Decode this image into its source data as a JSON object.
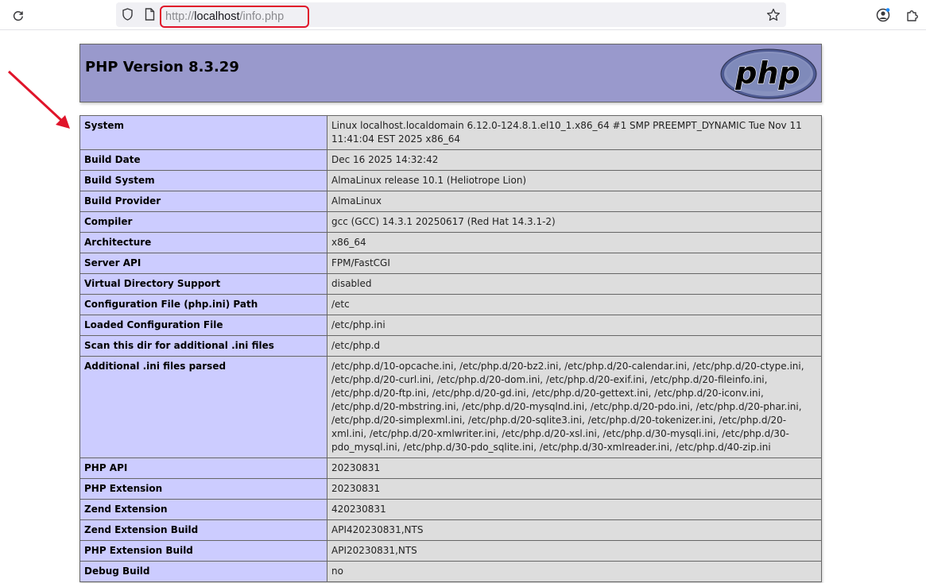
{
  "browser": {
    "url_scheme": "http://",
    "url_host": "localhost",
    "url_path": "/info.php",
    "icons": [
      "reload-icon",
      "shield-icon",
      "page-icon",
      "star-icon",
      "account-icon",
      "extensions-icon"
    ],
    "colors": {
      "highlight": "#e0142a",
      "arrow": "#e0142a"
    }
  },
  "phpinfo": {
    "title": "PHP Version 8.3.29",
    "logo_text": "php",
    "colors": {
      "header": "#9999cc",
      "key_cell": "#ccccff",
      "value_cell": "#dddddd"
    },
    "rows": [
      {
        "key": "System",
        "value": "Linux localhost.localdomain 6.12.0-124.8.1.el10_1.x86_64 #1 SMP PREEMPT_DYNAMIC Tue Nov 11 11:41:04 EST 2025 x86_64"
      },
      {
        "key": "Build Date",
        "value": "Dec 16 2025 14:32:42"
      },
      {
        "key": "Build System",
        "value": "AlmaLinux release 10.1 (Heliotrope Lion)"
      },
      {
        "key": "Build Provider",
        "value": "AlmaLinux"
      },
      {
        "key": "Compiler",
        "value": "gcc (GCC) 14.3.1 20250617 (Red Hat 14.3.1-2)"
      },
      {
        "key": "Architecture",
        "value": "x86_64"
      },
      {
        "key": "Server API",
        "value": "FPM/FastCGI"
      },
      {
        "key": "Virtual Directory Support",
        "value": "disabled"
      },
      {
        "key": "Configuration File (php.ini) Path",
        "value": "/etc"
      },
      {
        "key": "Loaded Configuration File",
        "value": "/etc/php.ini"
      },
      {
        "key": "Scan this dir for additional .ini files",
        "value": "/etc/php.d"
      },
      {
        "key": "Additional .ini files parsed",
        "value": "/etc/php.d/10-opcache.ini, /etc/php.d/20-bz2.ini, /etc/php.d/20-calendar.ini, /etc/php.d/20-ctype.ini, /etc/php.d/20-curl.ini, /etc/php.d/20-dom.ini, /etc/php.d/20-exif.ini, /etc/php.d/20-fileinfo.ini, /etc/php.d/20-ftp.ini, /etc/php.d/20-gd.ini, /etc/php.d/20-gettext.ini, /etc/php.d/20-iconv.ini, /etc/php.d/20-mbstring.ini, /etc/php.d/20-mysqlnd.ini, /etc/php.d/20-pdo.ini, /etc/php.d/20-phar.ini, /etc/php.d/20-simplexml.ini, /etc/php.d/20-sqlite3.ini, /etc/php.d/20-tokenizer.ini, /etc/php.d/20-xml.ini, /etc/php.d/20-xmlwriter.ini, /etc/php.d/20-xsl.ini, /etc/php.d/30-mysqli.ini, /etc/php.d/30-pdo_mysql.ini, /etc/php.d/30-pdo_sqlite.ini, /etc/php.d/30-xmlreader.ini, /etc/php.d/40-zip.ini"
      },
      {
        "key": "PHP API",
        "value": "20230831"
      },
      {
        "key": "PHP Extension",
        "value": "20230831"
      },
      {
        "key": "Zend Extension",
        "value": "420230831"
      },
      {
        "key": "Zend Extension Build",
        "value": "API420230831,NTS"
      },
      {
        "key": "PHP Extension Build",
        "value": "API20230831,NTS"
      },
      {
        "key": "Debug Build",
        "value": "no"
      }
    ]
  }
}
